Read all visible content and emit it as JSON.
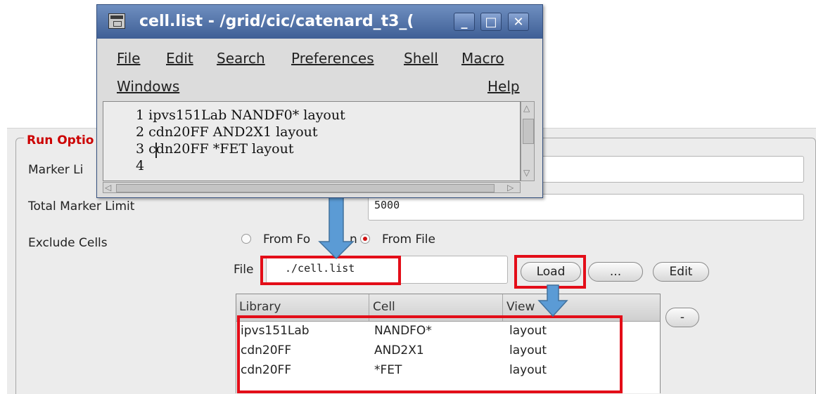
{
  "editor_window": {
    "title": "cell.list - /grid/cic/catenard_t3_(",
    "controls": {
      "minimize": "_",
      "maximize": "□",
      "close": "✕"
    },
    "menu": [
      "File",
      "Edit",
      "Search",
      "Preferences",
      "Shell",
      "Macro",
      "Windows",
      "Help"
    ],
    "lines": [
      {
        "num": "1",
        "text": "ipvs151Lab NANDF0* layout"
      },
      {
        "num": "2",
        "text": "cdn20FF AND2X1 layout"
      },
      {
        "num": "3",
        "text": "cdn20FF *FET layout"
      },
      {
        "num": "4",
        "text": ""
      }
    ]
  },
  "run_options": {
    "group_title": "Run Optio",
    "marker_limit_label": "Marker Li",
    "total_marker_limit_label": "Total Marker Limit",
    "total_marker_limit_value": "5000",
    "exclude_cells_label": "Exclude Cells",
    "radio_from_form": "From Fo",
    "radio_from_form_tail": "n",
    "radio_from_file": "From File",
    "file_label": "File",
    "file_value": "./cell.list",
    "load_button": "Load",
    "browse_button": "...",
    "edit_button": "Edit",
    "remove_button": "-",
    "table": {
      "headers": [
        "Library",
        "Cell",
        "View"
      ],
      "rows": [
        {
          "library": "ipvs151Lab",
          "cell": "NANDFO*",
          "view": "layout"
        },
        {
          "library": "cdn20FF",
          "cell": "AND2X1",
          "view": "layout"
        },
        {
          "library": "cdn20FF",
          "cell": "*FET",
          "view": "layout"
        }
      ]
    }
  },
  "colors": {
    "highlight": "#e30d18",
    "arrow": "#5b9bd5",
    "title_bar": "#4a6aa0",
    "group_title": "#cc0000"
  }
}
